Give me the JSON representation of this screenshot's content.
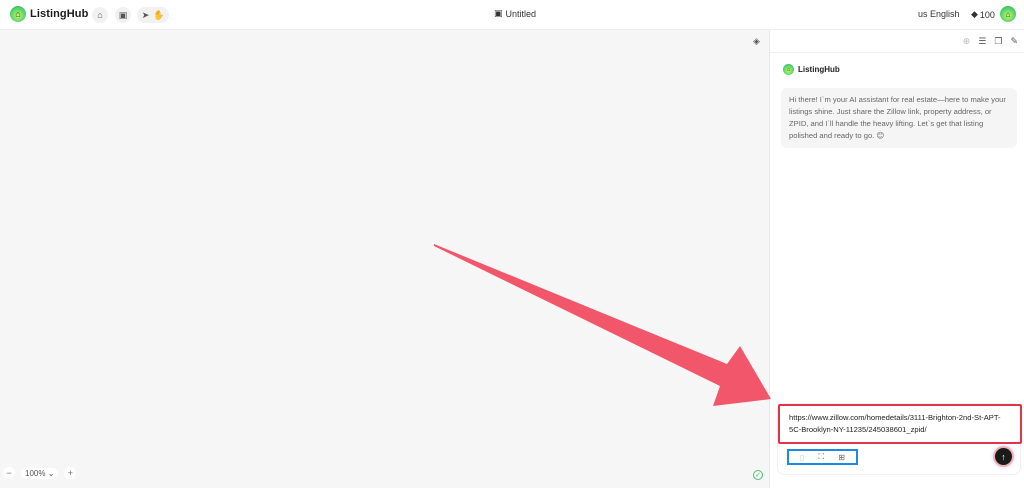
{
  "app": {
    "brand_name": "ListingHub",
    "document_title": "Untitled",
    "language": "us English",
    "credits": "100"
  },
  "toolbar": {
    "icons": [
      "home-icon",
      "folder-icon",
      "send-icon",
      "hand-icon"
    ]
  },
  "canvas": {
    "zoom_label": "100%",
    "zoom_out_label": "−",
    "zoom_in_label": "+"
  },
  "panel": {
    "assistant_name": "ListingHub",
    "greeting": "Hi there! I`m your AI assistant for real estate—here to make your listings shine. Just share the Zillow link, property address, or ZPID, and I`ll handle the heavy lifting. Let`s get that listing polished and ready to go. 😊",
    "input_value": "https://www.zillow.com/homedetails/3111-Brighton-2nd-St-APT-5C-Brooklyn-NY-11235/245038601_zpid/"
  },
  "colors": {
    "annotation_red": "#e0344a",
    "annotation_blue": "#1e88e5",
    "arrow": "#f2566b",
    "brand_green": "#4fd16a"
  }
}
